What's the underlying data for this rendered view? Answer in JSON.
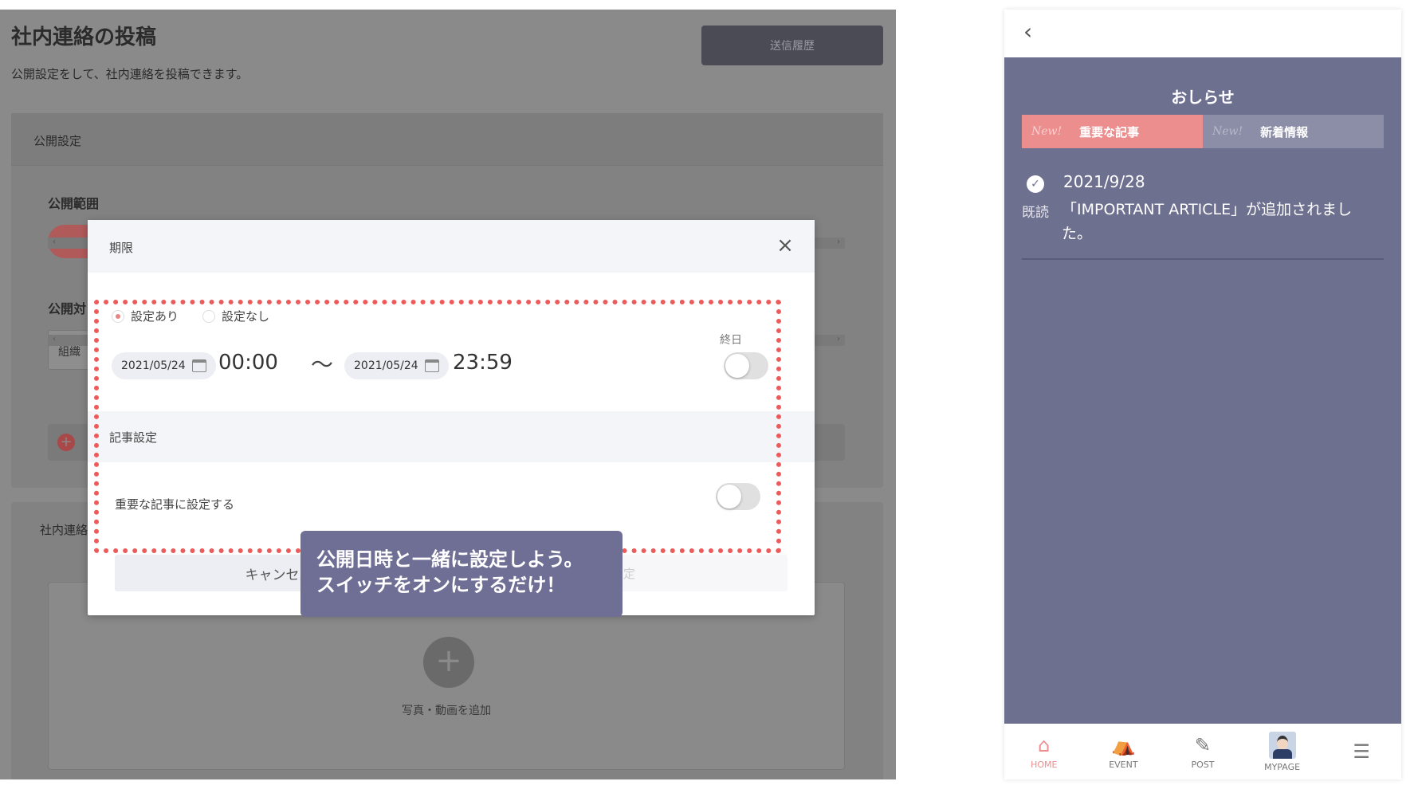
{
  "desktop": {
    "title": "社内連絡の投稿",
    "subtitle": "公開設定をして、社内連絡を投稿できます。",
    "history_button": "送信履歴",
    "settings_panel": {
      "title": "公開設定",
      "scope_label": "公開範囲",
      "target_label": "公開対",
      "target_value": "組織",
      "scroll_left": "‹",
      "scroll_right": "›"
    },
    "content_panel": {
      "label": "社内連絡",
      "upload_label": "写真・動画を追加",
      "upload_plus": "+"
    },
    "modal": {
      "title": "期限",
      "close": "×",
      "radio_on": "設定あり",
      "radio_off": "設定なし",
      "allday_label": "終日",
      "start_date": "2021/05/24",
      "start_time": "00:00",
      "tilde": "〜",
      "end_date": "2021/05/24",
      "end_time": "23:59",
      "article_section": "記事設定",
      "important_label": "重要な記事に設定する",
      "cancel": "キャンセル",
      "submit": "設定"
    },
    "callout": {
      "line1": "公開日時と一緒に設定しよう。",
      "line2": "スイッチをオンにするだけ！"
    },
    "colors": {
      "highlight": "#ee5a5a",
      "callout_bg": "#6f6f95"
    }
  },
  "phone": {
    "back_icon": "‹",
    "title": "おしらせ",
    "tabs": [
      {
        "new": "New!",
        "label": "重要な記事"
      },
      {
        "new": "New!",
        "label": "新着情報"
      }
    ],
    "news": {
      "check": "✓",
      "read_label": "既読",
      "date": "2021/9/28",
      "text": "「IMPORTANT ARTICLE」が追加されました。"
    },
    "nav": [
      {
        "icon": "home-icon",
        "glyph": "⌂",
        "label": "HOME"
      },
      {
        "icon": "event-icon",
        "glyph": "⛺",
        "label": "EVENT"
      },
      {
        "icon": "post-icon",
        "glyph": "✎",
        "label": "POST"
      },
      {
        "icon": "avatar",
        "glyph": "",
        "label": "MYPAGE"
      },
      {
        "icon": "menu-icon",
        "glyph": "☰",
        "label": ""
      }
    ],
    "colors": {
      "body_bg": "#6e7090",
      "accent": "#ec8e8e"
    }
  }
}
